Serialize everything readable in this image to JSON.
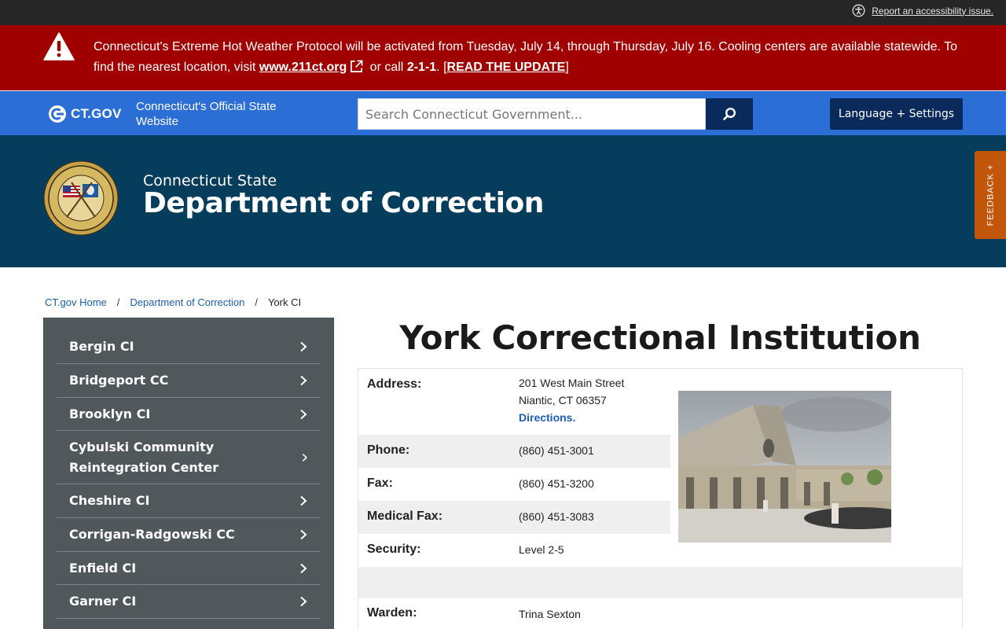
{
  "utility": {
    "accessibility_label": "Report an accessibility issue."
  },
  "alert": {
    "text1": "Connecticut's Extreme Hot Weather Protocol will be activated from Tuesday, July 14, through Thursday, July 16. Cooling centers are available statewide. To find the nearest location, visit ",
    "link_text": "www.211ct.org",
    "text2": " or call ",
    "phone": "2-1-1",
    "text3": ". [",
    "update_link": "READ THE UPDATE",
    "text4": "]"
  },
  "gov_bar": {
    "logo_text": "CT.GOV",
    "tagline": "Connecticut's Official State Website",
    "search_placeholder": "Search Connecticut Government...",
    "language_button": "Language + Settings"
  },
  "agency": {
    "subtitle": "Connecticut State",
    "title": "Department of Correction"
  },
  "feedback_label": "FEEDBACK +",
  "breadcrumb": [
    {
      "label": "CT.gov Home"
    },
    {
      "label": "Department of Correction"
    },
    {
      "label": "York CI"
    }
  ],
  "sidebar": {
    "items": [
      {
        "label": "Bergin CI"
      },
      {
        "label": "Bridgeport CC"
      },
      {
        "label": "Brooklyn CI"
      },
      {
        "label": "Cybulski Community Reintegration Center"
      },
      {
        "label": "Cheshire CI"
      },
      {
        "label": "Corrigan-Radgowski CC"
      },
      {
        "label": "Enfield CI"
      },
      {
        "label": "Garner CI"
      }
    ]
  },
  "main": {
    "title": "York Correctional Institution",
    "address_label": "Address:",
    "address_line1": "201 West Main Street",
    "address_line2": "Niantic, CT 06357",
    "directions": "Directions.",
    "phone_label": "Phone:",
    "phone": "(860) 451-3001",
    "fax_label": "Fax:",
    "fax": "(860) 451-3200",
    "medfax_label": "Medical Fax:",
    "medfax": "(860) 451-3083",
    "security_label": "Security:",
    "security": "Level 2-5",
    "warden_label": "Warden:",
    "warden": "Trina Sexton"
  }
}
